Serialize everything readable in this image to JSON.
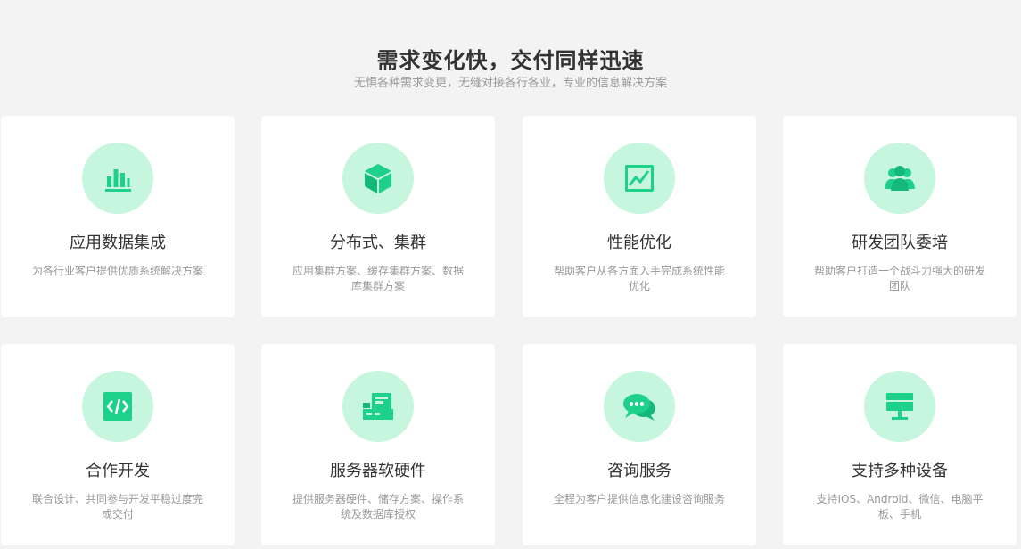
{
  "section": {
    "title": "需求变化快，交付同样迅速",
    "subtitle": "无惧各种需求变更，无缝对接各行各业，专业的信息解决方案"
  },
  "accent_color": "#1ed18b",
  "icon_bg_color": "#c6f6de",
  "cards": [
    {
      "icon": "bar-chart-icon",
      "title": "应用数据集成",
      "desc": "为各行业客户提供优质系统解决方案"
    },
    {
      "icon": "cube-icon",
      "title": "分布式、集群",
      "desc": "应用集群方案、缓存集群方案、数据库集群方案"
    },
    {
      "icon": "line-chart-icon",
      "title": "性能优化",
      "desc": "帮助客户从各方面入手完成系统性能优化"
    },
    {
      "icon": "team-icon",
      "title": "研发团队委培",
      "desc": "帮助客户打造一个战斗力强大的研发团队"
    },
    {
      "icon": "code-icon",
      "title": "合作开发",
      "desc": "联合设计、共同参与开发平稳过度完成交付"
    },
    {
      "icon": "server-icon",
      "title": "服务器软硬件",
      "desc": "提供服务器硬件、储存方案、操作系统及数据库授权"
    },
    {
      "icon": "chat-icon",
      "title": "咨询服务",
      "desc": "全程为客户提供信息化建设咨询服务"
    },
    {
      "icon": "monitor-icon",
      "title": "支持多种设备",
      "desc": "支持IOS、Android、微信、电脑平板、手机"
    }
  ]
}
